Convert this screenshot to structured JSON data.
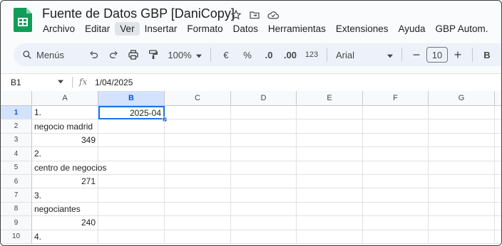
{
  "app": {
    "title": "Fuente de Datos GBP [DaniCopy]",
    "menu": [
      "Archivo",
      "Editar",
      "Ver",
      "Insertar",
      "Formato",
      "Datos",
      "Herramientas",
      "Extensiones",
      "Ayuda",
      "GBP Autom."
    ],
    "active_menu": "Ver"
  },
  "toolbar": {
    "search_label": "Menús",
    "zoom": "100%",
    "currency": "€",
    "percent": "%",
    "dec_decrease": ".0",
    "dec_increase": ".00",
    "number_format": "123",
    "font": "Arial",
    "font_size": "10",
    "bold": "B"
  },
  "formula_bar": {
    "name_box": "B1",
    "fx": "fx",
    "value": "1/04/2025"
  },
  "grid": {
    "columns": [
      "A",
      "B",
      "C",
      "D",
      "E",
      "F",
      "G"
    ],
    "selected_column": "B",
    "rows": [
      "1",
      "2",
      "3",
      "4",
      "5",
      "6",
      "7",
      "8",
      "9",
      "10"
    ],
    "selected_row": "1",
    "cells": {
      "A1": "1.",
      "B1": "2025-04",
      "A2": "negocio madrid",
      "A3": "349",
      "A4": "2.",
      "A5": "centro de negocios",
      "A6": "271",
      "A7": "3.",
      "A8": "negociantes",
      "A9": "240",
      "A10": "4."
    }
  },
  "colors": {
    "accent": "#1a73e8",
    "selected_header": "#d3e3fd",
    "toolbar_bg": "#edf2fa",
    "sheets_green": "#0f9d58"
  }
}
